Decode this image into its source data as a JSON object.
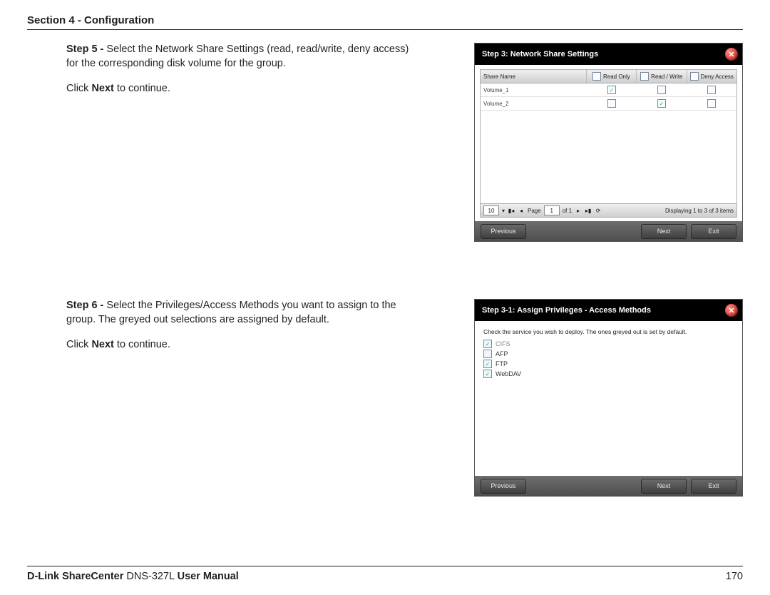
{
  "header": {
    "section": "Section 4 - Configuration"
  },
  "step5": {
    "label": "Step 5 - ",
    "desc": "Select the Network Share Settings (read, read/write, deny access) for the corresponding disk volume for the group.",
    "cont_pre": "Click ",
    "cont_bold": "Next",
    "cont_post": " to continue."
  },
  "step6": {
    "label": "Step 6 - ",
    "desc": "Select the Privileges/Access Methods you want to assign to the group. The greyed out selections are assigned by default.",
    "cont_pre": "Click ",
    "cont_bold": "Next",
    "cont_post": " to continue."
  },
  "dialog1": {
    "title": "Step 3: Network Share Settings",
    "cols": {
      "name": "Share Name",
      "ro": "Read Only",
      "rw": "Read / Write",
      "deny": "Deny Access"
    },
    "rows": [
      {
        "name": "Volume_1",
        "ro": true,
        "rw": false,
        "deny": false
      },
      {
        "name": "Volume_2",
        "ro": false,
        "rw": true,
        "deny": false
      }
    ],
    "pager": {
      "size": "10",
      "page_label": "Page",
      "page": "1",
      "of_label": "of 1",
      "status": "Displaying 1 to 3 of 3 items"
    },
    "buttons": {
      "prev": "Previous",
      "next": "Next",
      "exit": "Exit"
    }
  },
  "dialog2": {
    "title": "Step 3-1: Assign Privileges - Access Methods",
    "hint": "Check the service you wish to deploy. The ones greyed out is set by default.",
    "services": [
      {
        "name": "CIFS",
        "checked": true,
        "greyed": true
      },
      {
        "name": "AFP",
        "checked": false,
        "greyed": false
      },
      {
        "name": "FTP",
        "checked": true,
        "greyed": false
      },
      {
        "name": "WebDAV",
        "checked": true,
        "greyed": false
      }
    ],
    "buttons": {
      "prev": "Previous",
      "next": "Next",
      "exit": "Exit"
    }
  },
  "footer": {
    "brand1": "D-Link ShareCenter",
    "model": " DNS-327L ",
    "brand2": "User Manual",
    "pagenum": "170"
  }
}
